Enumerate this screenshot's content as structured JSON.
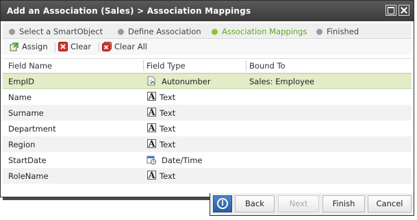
{
  "window": {
    "title": "Add an Association (Sales) > Association Mappings"
  },
  "steps": [
    {
      "label": "Select a SmartObject",
      "active": false
    },
    {
      "label": "Define Association",
      "active": false
    },
    {
      "label": "Association Mappings",
      "active": true
    },
    {
      "label": "Finished",
      "active": false
    }
  ],
  "toolbar": {
    "assign": "Assign",
    "clear": "Clear",
    "clear_all": "Clear All"
  },
  "grid": {
    "columns": [
      "Field Name",
      "Field Type",
      "Bound To"
    ],
    "rows": [
      {
        "name": "EmpID",
        "type": "Autonumber",
        "type_icon": "autonumber-icon",
        "bound": "Sales: Employee",
        "selected": true
      },
      {
        "name": "Name",
        "type": "Text",
        "type_icon": "text-icon",
        "bound": ""
      },
      {
        "name": "Surname",
        "type": "Text",
        "type_icon": "text-icon",
        "bound": ""
      },
      {
        "name": "Department",
        "type": "Text",
        "type_icon": "text-icon",
        "bound": ""
      },
      {
        "name": "Region",
        "type": "Text",
        "type_icon": "text-icon",
        "bound": ""
      },
      {
        "name": "StartDate",
        "type": "Date/Time",
        "type_icon": "datetime-icon",
        "bound": ""
      },
      {
        "name": "RoleName",
        "type": "Text",
        "type_icon": "text-icon",
        "bound": ""
      }
    ]
  },
  "footer": {
    "back": "Back",
    "next": "Next",
    "finish": "Finish",
    "cancel": "Cancel",
    "info_glyph": "i"
  },
  "colors": {
    "title_bg": "#444444",
    "active_step": "#66a422",
    "selected_row": "#e2ecc8"
  }
}
